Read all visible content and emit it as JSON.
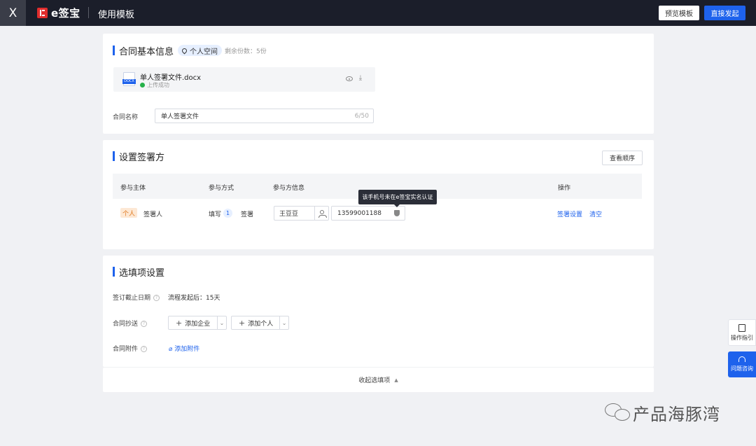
{
  "header": {
    "close": "X",
    "brand": "e签宝",
    "title": "使用模板",
    "preview_button": "预览模板",
    "start_button": "直接发起"
  },
  "basic_info": {
    "title": "合同基本信息",
    "space_badge": "个人空间",
    "remaining": "剩余份数：5份",
    "file": {
      "name": "单人签署文件.docx",
      "type_tag": "DOCX",
      "status": "上传成功"
    },
    "contract_name_label": "合同名称",
    "contract_name_value": "单人签署文件",
    "contract_name_count": "6/50"
  },
  "signers": {
    "title": "设置签署方",
    "order_button": "查看顺序",
    "columns": [
      "参与主体",
      "参与方式",
      "参与方信息",
      "操作"
    ],
    "row": {
      "subject_badge": "个人",
      "subject_role": "签署人",
      "method": "填写",
      "method_count": "1",
      "method_action": "签署",
      "name": "王豆豆",
      "phone": "13599001188",
      "tooltip": "该手机号未在e签宝实名认证",
      "action_settings": "签署设置",
      "action_clear": "清空"
    }
  },
  "options": {
    "title": "选填项设置",
    "deadline_label": "签订截止日期",
    "deadline_value": "流程发起后：15天",
    "cc_label": "合同抄送",
    "add_company": "添加企业",
    "add_person": "添加个人",
    "attachment_label": "合同附件",
    "add_attachment": "添加附件",
    "collapse": "收起选填项"
  },
  "side_help": {
    "guide": "操作指引",
    "consult": "问题咨询"
  },
  "watermark": "产品海豚湾"
}
